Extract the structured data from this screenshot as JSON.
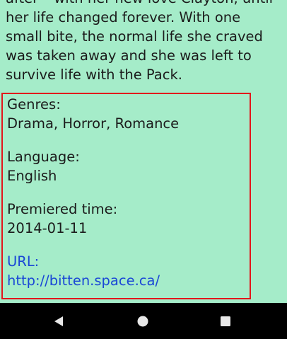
{
  "synopsis": {
    "lines": [
      "after – with her new love Clayton, until",
      "her life changed forever. With one",
      "small bite, the normal life she craved",
      "was taken away and she was left to",
      "survive life with the Pack."
    ]
  },
  "details": {
    "genres_label": "Genres:",
    "genres_value": "Drama, Horror, Romance",
    "language_label": "Language:",
    "language_value": "English",
    "premiered_label": "Premiered time:",
    "premiered_value": "2014-01-11",
    "url_label": "URL:",
    "url_value": "http://bitten.space.ca/"
  },
  "navbar": {
    "back_icon": "back-triangle-icon",
    "home_icon": "home-circle-icon",
    "recents_icon": "recents-square-icon"
  },
  "colors": {
    "background": "#a5ecc9",
    "highlight_border": "#e2161b",
    "link": "#1a47d6",
    "navbar": "#000000"
  }
}
